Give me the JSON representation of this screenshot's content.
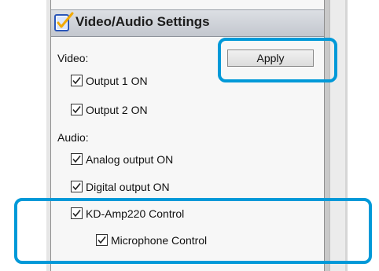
{
  "panel": {
    "title": "Video/Audio Settings",
    "apply_label": "Apply"
  },
  "video": {
    "label": "Video:",
    "items": [
      {
        "label": "Output 1 ON",
        "checked": true
      },
      {
        "label": "Output 2 ON",
        "checked": true
      }
    ]
  },
  "audio": {
    "label": "Audio:",
    "items": [
      {
        "label": "Analog output ON",
        "checked": true
      },
      {
        "label": "Digital output ON",
        "checked": true
      },
      {
        "label": "KD-Amp220 Control",
        "checked": true
      },
      {
        "label": "Microphone Control",
        "checked": true
      }
    ]
  },
  "colors": {
    "highlight": "#0099d8",
    "header_bg": "#c9ccd2"
  },
  "icons": {
    "header": "settings-check-icon",
    "checkbox": "checkmark-icon"
  }
}
